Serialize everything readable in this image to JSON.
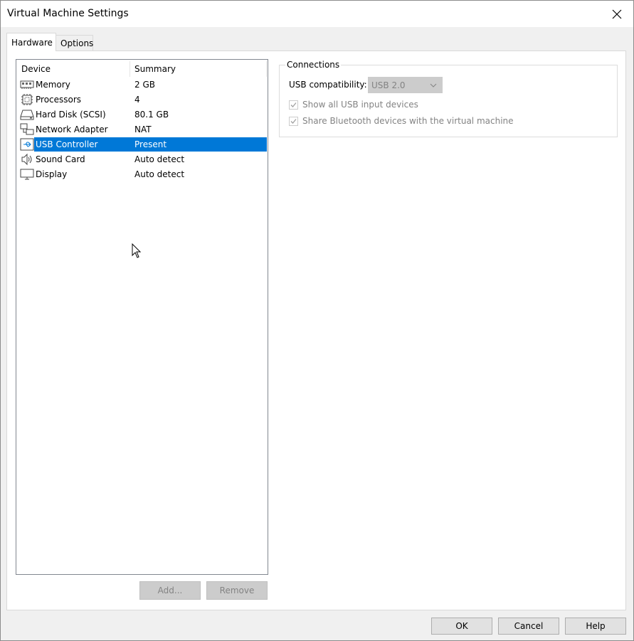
{
  "window": {
    "title": "Virtual Machine Settings"
  },
  "tabs": [
    {
      "label": "Hardware",
      "active": true
    },
    {
      "label": "Options",
      "active": false
    }
  ],
  "device_list": {
    "columns": [
      "Device",
      "Summary"
    ],
    "rows": [
      {
        "icon": "memory-icon",
        "device": "Memory",
        "summary": "2 GB"
      },
      {
        "icon": "processor-icon",
        "device": "Processors",
        "summary": "4"
      },
      {
        "icon": "hard-disk-icon",
        "device": "Hard Disk (SCSI)",
        "summary": "80.1 GB"
      },
      {
        "icon": "network-adapter-icon",
        "device": "Network Adapter",
        "summary": "NAT"
      },
      {
        "icon": "usb-icon",
        "device": "USB Controller",
        "summary": "Present",
        "selected": true
      },
      {
        "icon": "speaker-icon",
        "device": "Sound Card",
        "summary": "Auto detect"
      },
      {
        "icon": "monitor-icon",
        "device": "Display",
        "summary": "Auto detect"
      }
    ]
  },
  "list_buttons": {
    "add": "Add...",
    "remove": "Remove"
  },
  "connections": {
    "legend": "Connections",
    "usb_compat_label": "USB compatibility:",
    "usb_compat_value": "USB 2.0",
    "show_all_usb": "Show all USB input devices",
    "share_bluetooth": "Share Bluetooth devices with the virtual machine"
  },
  "footer_buttons": {
    "ok": "OK",
    "cancel": "Cancel",
    "help": "Help"
  },
  "colors": {
    "selection": "#0078d7",
    "disabled_text": "#838383"
  }
}
